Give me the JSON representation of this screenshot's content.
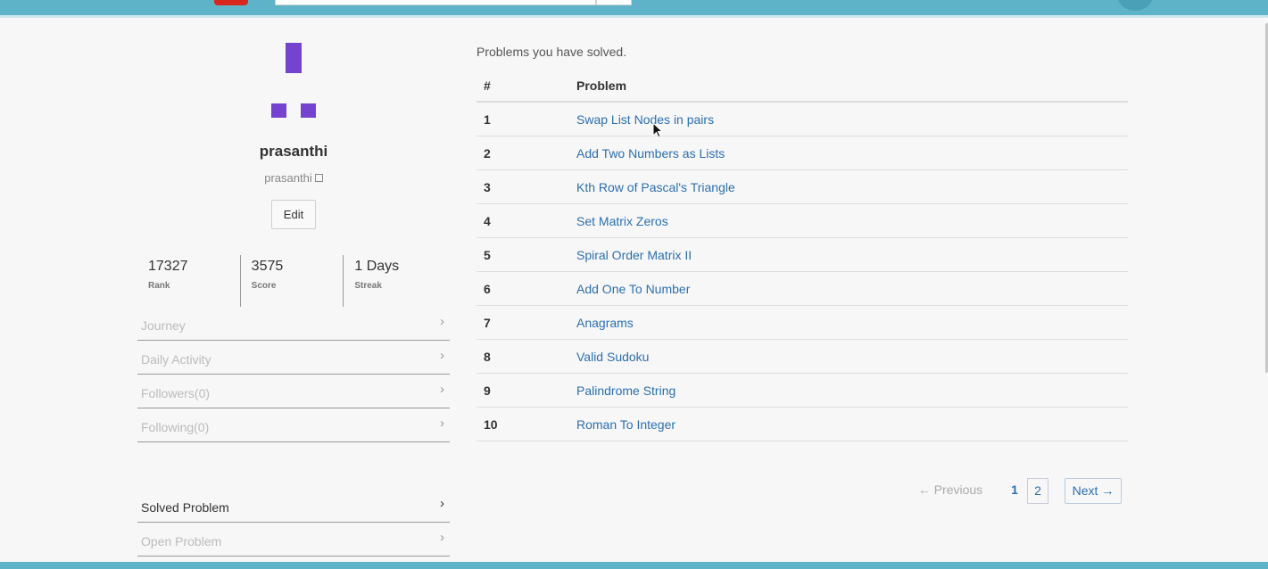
{
  "profile": {
    "name": "prasanthi",
    "handle": "prasanthi",
    "edit_label": "Edit",
    "identicon_color": "#7444cf"
  },
  "stats": [
    {
      "value": "17327",
      "label": "Rank"
    },
    {
      "value": "3575",
      "label": "Score"
    },
    {
      "value": "1 Days",
      "label": "Streak"
    }
  ],
  "menu_top": [
    {
      "label": "Journey"
    },
    {
      "label": "Daily Activity"
    },
    {
      "label": "Followers(0)"
    },
    {
      "label": "Following(0)"
    }
  ],
  "menu_bottom": [
    {
      "label": "Solved Problem"
    },
    {
      "label": "Open Problem"
    }
  ],
  "problems": {
    "caption": "Problems you have solved.",
    "header_num": "#",
    "header_problem": "Problem",
    "rows": [
      {
        "num": "1",
        "title": "Swap List Nodes in pairs"
      },
      {
        "num": "2",
        "title": "Add Two Numbers as Lists"
      },
      {
        "num": "3",
        "title": "Kth Row of Pascal's Triangle"
      },
      {
        "num": "4",
        "title": "Set Matrix Zeros"
      },
      {
        "num": "5",
        "title": "Spiral Order Matrix II"
      },
      {
        "num": "6",
        "title": "Add One To Number"
      },
      {
        "num": "7",
        "title": "Anagrams"
      },
      {
        "num": "8",
        "title": "Valid Sudoku"
      },
      {
        "num": "9",
        "title": "Palindrome String"
      },
      {
        "num": "10",
        "title": "Roman To Integer"
      }
    ]
  },
  "pagination": {
    "prev": "← Previous",
    "page1": "1",
    "page2": "2",
    "next": "Next →"
  },
  "colors": {
    "topbar": "#5fb3c8",
    "link": "#2a6fb0"
  }
}
